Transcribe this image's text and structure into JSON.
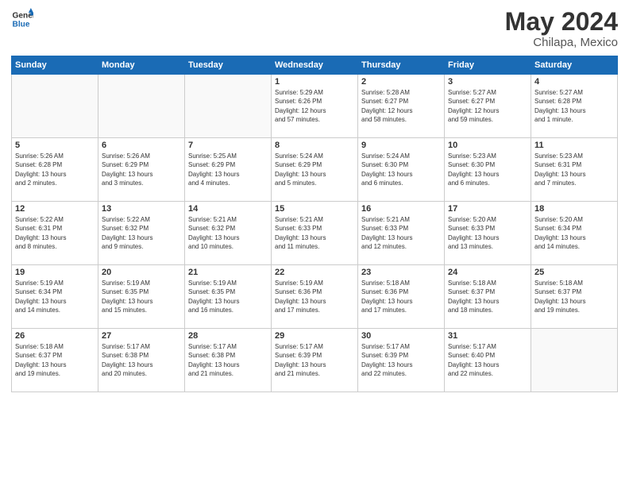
{
  "logo": {
    "line1": "General",
    "line2": "Blue"
  },
  "title": "May 2024",
  "location": "Chilapa, Mexico",
  "days_header": [
    "Sunday",
    "Monday",
    "Tuesday",
    "Wednesday",
    "Thursday",
    "Friday",
    "Saturday"
  ],
  "weeks": [
    [
      {
        "num": "",
        "info": ""
      },
      {
        "num": "",
        "info": ""
      },
      {
        "num": "",
        "info": ""
      },
      {
        "num": "1",
        "info": "Sunrise: 5:29 AM\nSunset: 6:26 PM\nDaylight: 12 hours\nand 57 minutes."
      },
      {
        "num": "2",
        "info": "Sunrise: 5:28 AM\nSunset: 6:27 PM\nDaylight: 12 hours\nand 58 minutes."
      },
      {
        "num": "3",
        "info": "Sunrise: 5:27 AM\nSunset: 6:27 PM\nDaylight: 12 hours\nand 59 minutes."
      },
      {
        "num": "4",
        "info": "Sunrise: 5:27 AM\nSunset: 6:28 PM\nDaylight: 13 hours\nand 1 minute."
      }
    ],
    [
      {
        "num": "5",
        "info": "Sunrise: 5:26 AM\nSunset: 6:28 PM\nDaylight: 13 hours\nand 2 minutes."
      },
      {
        "num": "6",
        "info": "Sunrise: 5:26 AM\nSunset: 6:29 PM\nDaylight: 13 hours\nand 3 minutes."
      },
      {
        "num": "7",
        "info": "Sunrise: 5:25 AM\nSunset: 6:29 PM\nDaylight: 13 hours\nand 4 minutes."
      },
      {
        "num": "8",
        "info": "Sunrise: 5:24 AM\nSunset: 6:29 PM\nDaylight: 13 hours\nand 5 minutes."
      },
      {
        "num": "9",
        "info": "Sunrise: 5:24 AM\nSunset: 6:30 PM\nDaylight: 13 hours\nand 6 minutes."
      },
      {
        "num": "10",
        "info": "Sunrise: 5:23 AM\nSunset: 6:30 PM\nDaylight: 13 hours\nand 6 minutes."
      },
      {
        "num": "11",
        "info": "Sunrise: 5:23 AM\nSunset: 6:31 PM\nDaylight: 13 hours\nand 7 minutes."
      }
    ],
    [
      {
        "num": "12",
        "info": "Sunrise: 5:22 AM\nSunset: 6:31 PM\nDaylight: 13 hours\nand 8 minutes."
      },
      {
        "num": "13",
        "info": "Sunrise: 5:22 AM\nSunset: 6:32 PM\nDaylight: 13 hours\nand 9 minutes."
      },
      {
        "num": "14",
        "info": "Sunrise: 5:21 AM\nSunset: 6:32 PM\nDaylight: 13 hours\nand 10 minutes."
      },
      {
        "num": "15",
        "info": "Sunrise: 5:21 AM\nSunset: 6:33 PM\nDaylight: 13 hours\nand 11 minutes."
      },
      {
        "num": "16",
        "info": "Sunrise: 5:21 AM\nSunset: 6:33 PM\nDaylight: 13 hours\nand 12 minutes."
      },
      {
        "num": "17",
        "info": "Sunrise: 5:20 AM\nSunset: 6:33 PM\nDaylight: 13 hours\nand 13 minutes."
      },
      {
        "num": "18",
        "info": "Sunrise: 5:20 AM\nSunset: 6:34 PM\nDaylight: 13 hours\nand 14 minutes."
      }
    ],
    [
      {
        "num": "19",
        "info": "Sunrise: 5:19 AM\nSunset: 6:34 PM\nDaylight: 13 hours\nand 14 minutes."
      },
      {
        "num": "20",
        "info": "Sunrise: 5:19 AM\nSunset: 6:35 PM\nDaylight: 13 hours\nand 15 minutes."
      },
      {
        "num": "21",
        "info": "Sunrise: 5:19 AM\nSunset: 6:35 PM\nDaylight: 13 hours\nand 16 minutes."
      },
      {
        "num": "22",
        "info": "Sunrise: 5:19 AM\nSunset: 6:36 PM\nDaylight: 13 hours\nand 17 minutes."
      },
      {
        "num": "23",
        "info": "Sunrise: 5:18 AM\nSunset: 6:36 PM\nDaylight: 13 hours\nand 17 minutes."
      },
      {
        "num": "24",
        "info": "Sunrise: 5:18 AM\nSunset: 6:37 PM\nDaylight: 13 hours\nand 18 minutes."
      },
      {
        "num": "25",
        "info": "Sunrise: 5:18 AM\nSunset: 6:37 PM\nDaylight: 13 hours\nand 19 minutes."
      }
    ],
    [
      {
        "num": "26",
        "info": "Sunrise: 5:18 AM\nSunset: 6:37 PM\nDaylight: 13 hours\nand 19 minutes."
      },
      {
        "num": "27",
        "info": "Sunrise: 5:17 AM\nSunset: 6:38 PM\nDaylight: 13 hours\nand 20 minutes."
      },
      {
        "num": "28",
        "info": "Sunrise: 5:17 AM\nSunset: 6:38 PM\nDaylight: 13 hours\nand 21 minutes."
      },
      {
        "num": "29",
        "info": "Sunrise: 5:17 AM\nSunset: 6:39 PM\nDaylight: 13 hours\nand 21 minutes."
      },
      {
        "num": "30",
        "info": "Sunrise: 5:17 AM\nSunset: 6:39 PM\nDaylight: 13 hours\nand 22 minutes."
      },
      {
        "num": "31",
        "info": "Sunrise: 5:17 AM\nSunset: 6:40 PM\nDaylight: 13 hours\nand 22 minutes."
      },
      {
        "num": "",
        "info": ""
      }
    ]
  ]
}
